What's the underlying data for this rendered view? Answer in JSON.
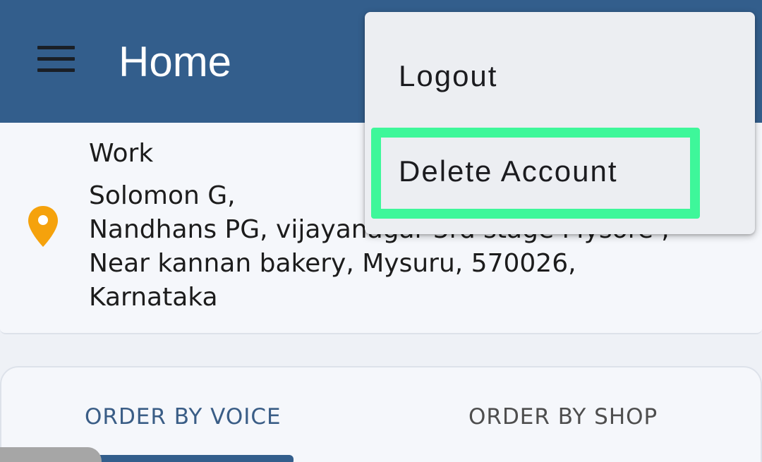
{
  "app_bar": {
    "title": "Home",
    "menu_icon": "hamburger-menu-icon",
    "color": "#335e8c"
  },
  "address": {
    "icon": "location-pin-icon",
    "icon_color": "#f5a20c",
    "label": "Work",
    "lines": [
      "Solomon G,",
      "Nandhans PG, vijayanagar 3rd stage Mysore ,",
      "Near kannan bakery, Mysuru, 570026,",
      "Karnataka"
    ]
  },
  "order_tabs": {
    "items": [
      {
        "label": "ORDER BY VOICE",
        "selected": true
      },
      {
        "label": "ORDER BY SHOP",
        "selected": false
      }
    ]
  },
  "overflow_menu": {
    "items": [
      {
        "label": "Logout"
      },
      {
        "label": "Delete Account",
        "highlighted": true
      }
    ],
    "highlight_color": "#3ef79a"
  }
}
